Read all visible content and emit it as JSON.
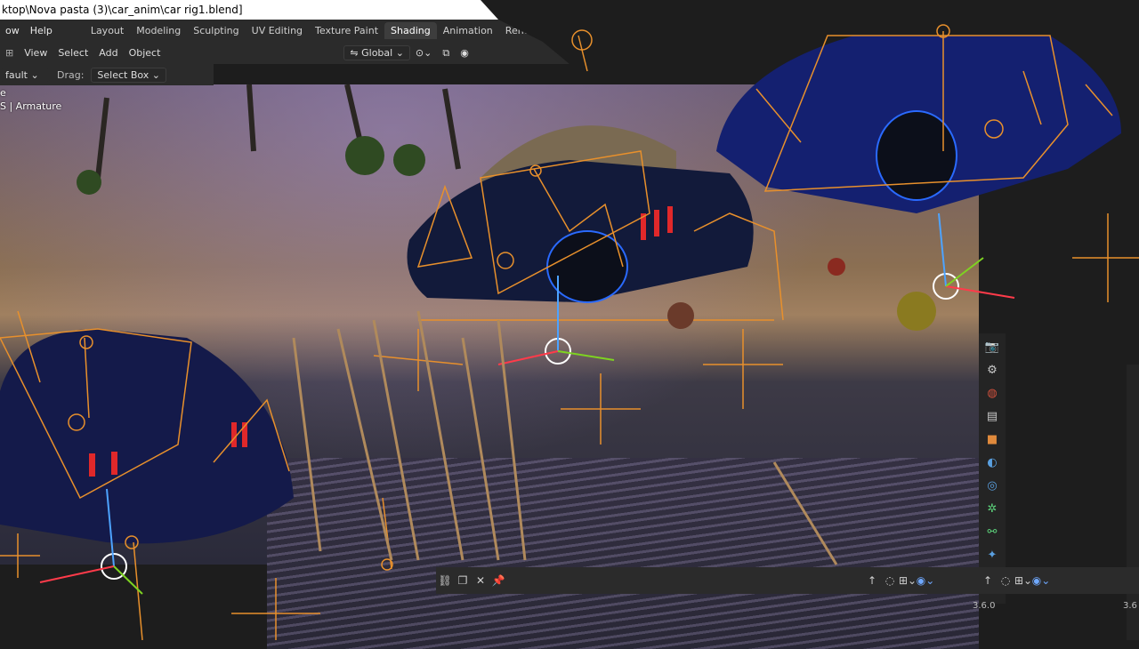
{
  "title_bar": {
    "text": "ktop\\Nova pasta (3)\\car_anim\\car rig1.blend]"
  },
  "menu": {
    "left": [
      "ow",
      "Help"
    ]
  },
  "workspace_tabs": [
    "Layout",
    "Modeling",
    "Sculpting",
    "UV Editing",
    "Texture Paint",
    "Shading",
    "Animation",
    "Rendering"
  ],
  "active_tab": "Shading",
  "viewport_header": {
    "menus": [
      "View",
      "Select",
      "Add",
      "Object"
    ],
    "orientation": "Global"
  },
  "tool_header": {
    "preset": "fault",
    "drag_label": "Drag:",
    "drag_value": "Select Box"
  },
  "viewport_overlay": {
    "line1": "e",
    "line2": "S | Armature"
  },
  "version": "3.6.0",
  "version_right": "3.6",
  "colors": {
    "accent": "#4772b3",
    "bone": "#e8902c",
    "header": "#2b2b2b"
  }
}
